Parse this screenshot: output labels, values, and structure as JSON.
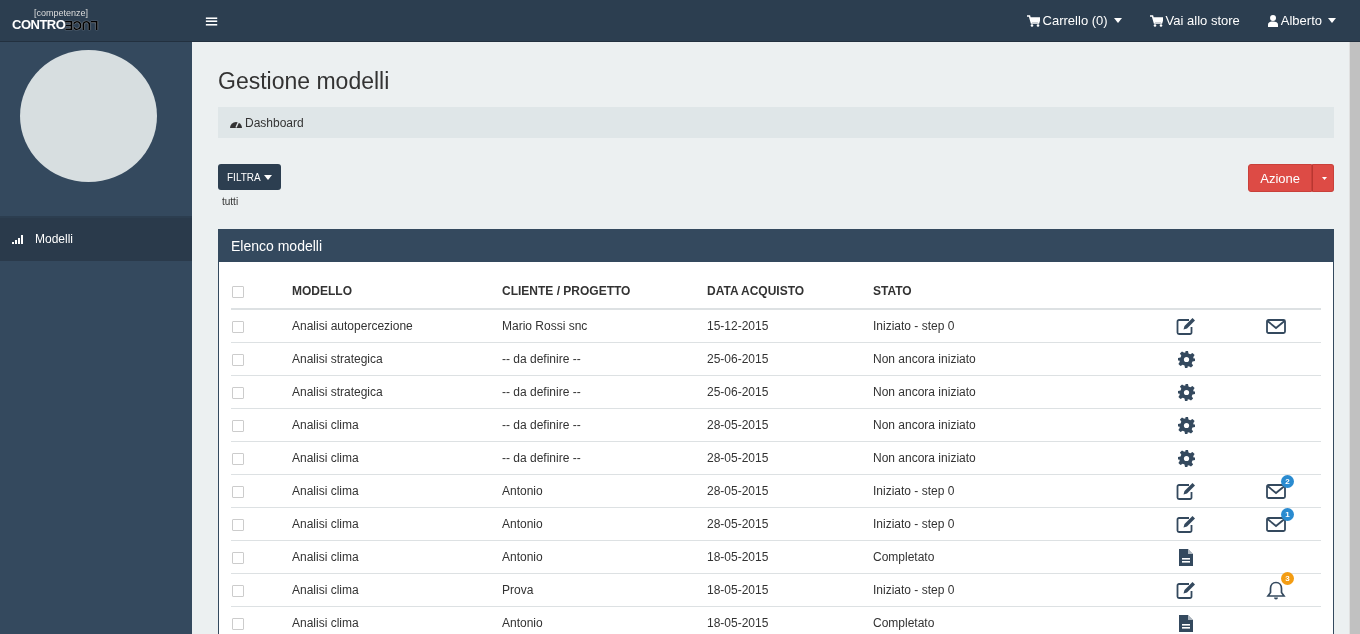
{
  "logo": {
    "tagline": "[competenze]",
    "word_a": "CONTRO",
    "word_b": "LUCE"
  },
  "topbar": {
    "menu_icon": "≡",
    "items": [
      {
        "kind": "cart",
        "label": "Carrello (0)",
        "dropdown": true
      },
      {
        "kind": "cart",
        "label": "Vai allo store",
        "dropdown": false
      },
      {
        "kind": "user",
        "label": "Alberto",
        "dropdown": true
      }
    ]
  },
  "sidebar": {
    "items": [
      {
        "label": "Modelli",
        "selected": true
      }
    ]
  },
  "page": {
    "title": "Gestione modelli",
    "breadcrumb": "Dashboard",
    "filter_button": "FILTRA",
    "filter_value": "tutti",
    "action_button": "Azione"
  },
  "table": {
    "title": "Elenco modelli",
    "columns": [
      "MODELLO",
      "CLIENTE / PROGETTO",
      "DATA ACQUISTO",
      "STATO"
    ],
    "select_all_checked": false,
    "rows": [
      {
        "checked": false,
        "modello": "Analisi autopercezione",
        "cliente": "Mario Rossi snc",
        "data": "15-12-2015",
        "stato": "Iniziato - step 0",
        "action": {
          "kind": "edit"
        },
        "notify": {
          "kind": "mail"
        }
      },
      {
        "checked": false,
        "modello": "Analisi strategica",
        "cliente": "-- da definire --",
        "data": "25-06-2015",
        "stato": "Non ancora iniziato",
        "action": {
          "kind": "settings"
        }
      },
      {
        "checked": false,
        "modello": "Analisi strategica",
        "cliente": "-- da definire --",
        "data": "25-06-2015",
        "stato": "Non ancora iniziato",
        "action": {
          "kind": "settings"
        }
      },
      {
        "checked": false,
        "modello": "Analisi clima",
        "cliente": "-- da definire --",
        "data": "28-05-2015",
        "stato": "Non ancora iniziato",
        "action": {
          "kind": "settings"
        }
      },
      {
        "checked": false,
        "modello": "Analisi clima",
        "cliente": "-- da definire --",
        "data": "28-05-2015",
        "stato": "Non ancora iniziato",
        "action": {
          "kind": "settings"
        }
      },
      {
        "checked": false,
        "modello": "Analisi clima",
        "cliente": "Antonio",
        "data": "28-05-2015",
        "stato": "Iniziato - step 0",
        "action": {
          "kind": "edit"
        },
        "notify": {
          "kind": "mail",
          "badge": {
            "count": "2",
            "color": "#2a8bd0"
          }
        }
      },
      {
        "checked": false,
        "modello": "Analisi clima",
        "cliente": "Antonio",
        "data": "28-05-2015",
        "stato": "Iniziato - step 0",
        "action": {
          "kind": "edit"
        },
        "notify": {
          "kind": "mail",
          "badge": {
            "count": "1",
            "color": "#2a8bd0"
          }
        }
      },
      {
        "checked": false,
        "modello": "Analisi clima",
        "cliente": "Antonio",
        "data": "18-05-2015",
        "stato": "Completato",
        "action": {
          "kind": "document"
        }
      },
      {
        "checked": false,
        "modello": "Analisi clima",
        "cliente": "Prova",
        "data": "18-05-2015",
        "stato": "Iniziato - step 0",
        "action": {
          "kind": "edit"
        },
        "notify": {
          "kind": "bell",
          "badge": {
            "count": "3",
            "color": "#f39c12"
          }
        }
      },
      {
        "checked": false,
        "modello": "Analisi clima",
        "cliente": "Antonio",
        "data": "18-05-2015",
        "stato": "Completato",
        "action": {
          "kind": "document"
        }
      }
    ]
  }
}
